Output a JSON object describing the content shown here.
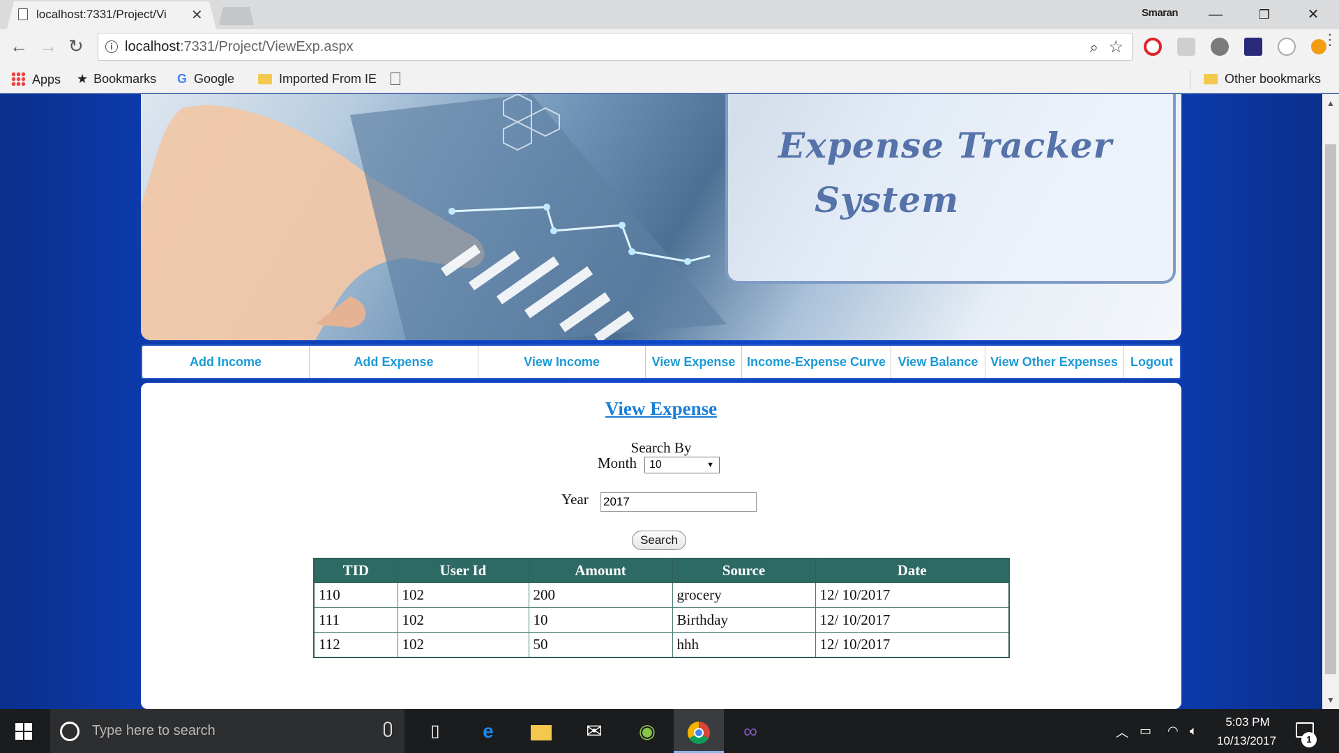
{
  "browser": {
    "tab_title": "localhost:7331/Project/Vi",
    "profile_name": "Smaran",
    "url_host": "localhost",
    "url_path": ":7331/Project/ViewExp.aspx",
    "bookmarks": {
      "apps": "Apps",
      "bookmarks": "Bookmarks",
      "google": "Google",
      "imported": "Imported From IE",
      "other": "Other bookmarks"
    },
    "icons": {
      "back": "arrow-left",
      "forward": "arrow-right",
      "reload": "reload",
      "zoom": "magnifier",
      "star": "star",
      "menu": "three-dots"
    }
  },
  "banner": {
    "title_line1": "Expense  Tracker",
    "title_line2": "System"
  },
  "menu": {
    "items": [
      "Add Income",
      "Add Expense",
      "View Income",
      "View Expense",
      "Income-Expense Curve",
      "View Balance",
      "View Other Expenses",
      "Logout"
    ]
  },
  "content": {
    "heading": "View Expense",
    "search_by": "Search By",
    "month_label": "Month",
    "month_value": "10",
    "year_label": "Year",
    "year_value": "2017",
    "search_button": "Search",
    "table": {
      "headers": [
        "TID",
        "User Id",
        "Amount",
        "Source",
        "Date"
      ],
      "rows": [
        [
          "110",
          "102",
          "200",
          "grocery",
          "12/ 10/2017"
        ],
        [
          "111",
          "102",
          "10",
          "Birthday",
          "12/ 10/2017"
        ],
        [
          "112",
          "102",
          "50",
          "hhh",
          "12/ 10/2017"
        ]
      ]
    }
  },
  "taskbar": {
    "search_placeholder": "Type here to search",
    "time": "5:03 PM",
    "date": "10/13/2017",
    "notification_count": "1"
  },
  "colors": {
    "menu_text": "#1a9ad6",
    "heading": "#1a7fd6",
    "table_header": "#2e6a64",
    "title_text": "#5572a9"
  }
}
